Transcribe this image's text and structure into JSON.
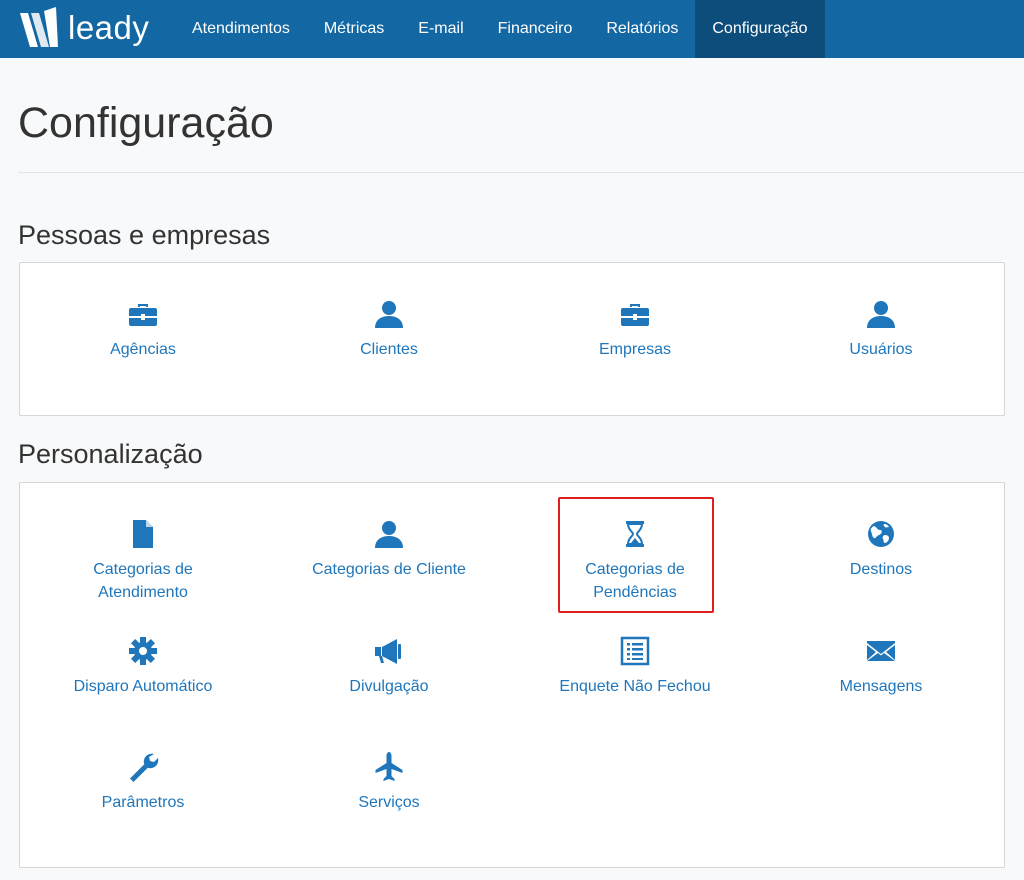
{
  "navbar": {
    "brand": "leady",
    "items": [
      {
        "label": "Atendimentos",
        "active": false
      },
      {
        "label": "Métricas",
        "active": false
      },
      {
        "label": "E-mail",
        "active": false
      },
      {
        "label": "Financeiro",
        "active": false
      },
      {
        "label": "Relatórios",
        "active": false
      },
      {
        "label": "Configuração",
        "active": true
      }
    ]
  },
  "page": {
    "title": "Configuração"
  },
  "sections": [
    {
      "title": "Pessoas e empresas",
      "items": [
        {
          "label": "Agências",
          "icon": "briefcase-icon"
        },
        {
          "label": "Clientes",
          "icon": "user-icon"
        },
        {
          "label": "Empresas",
          "icon": "briefcase-icon"
        },
        {
          "label": "Usuários",
          "icon": "user-icon"
        }
      ]
    },
    {
      "title": "Personalização",
      "items": [
        {
          "label": "Categorias de Atendimento",
          "icon": "file-icon"
        },
        {
          "label": "Categorias de Cliente",
          "icon": "user-icon"
        },
        {
          "label": "Categorias de Pendências",
          "icon": "hourglass-icon",
          "highlighted": true
        },
        {
          "label": "Destinos",
          "icon": "globe-icon"
        },
        {
          "label": "Disparo Automático",
          "icon": "gear-icon"
        },
        {
          "label": "Divulgação",
          "icon": "megaphone-icon"
        },
        {
          "label": "Enquete Não Fechou",
          "icon": "list-icon"
        },
        {
          "label": "Mensagens",
          "icon": "envelope-icon"
        },
        {
          "label": "Parâmetros",
          "icon": "wrench-icon"
        },
        {
          "label": "Serviços",
          "icon": "plane-icon"
        }
      ]
    }
  ],
  "colors": {
    "navbar": "#1367a2",
    "navbar_active": "#0d4d7c",
    "link": "#1f76bb",
    "highlight": "#e02020"
  }
}
